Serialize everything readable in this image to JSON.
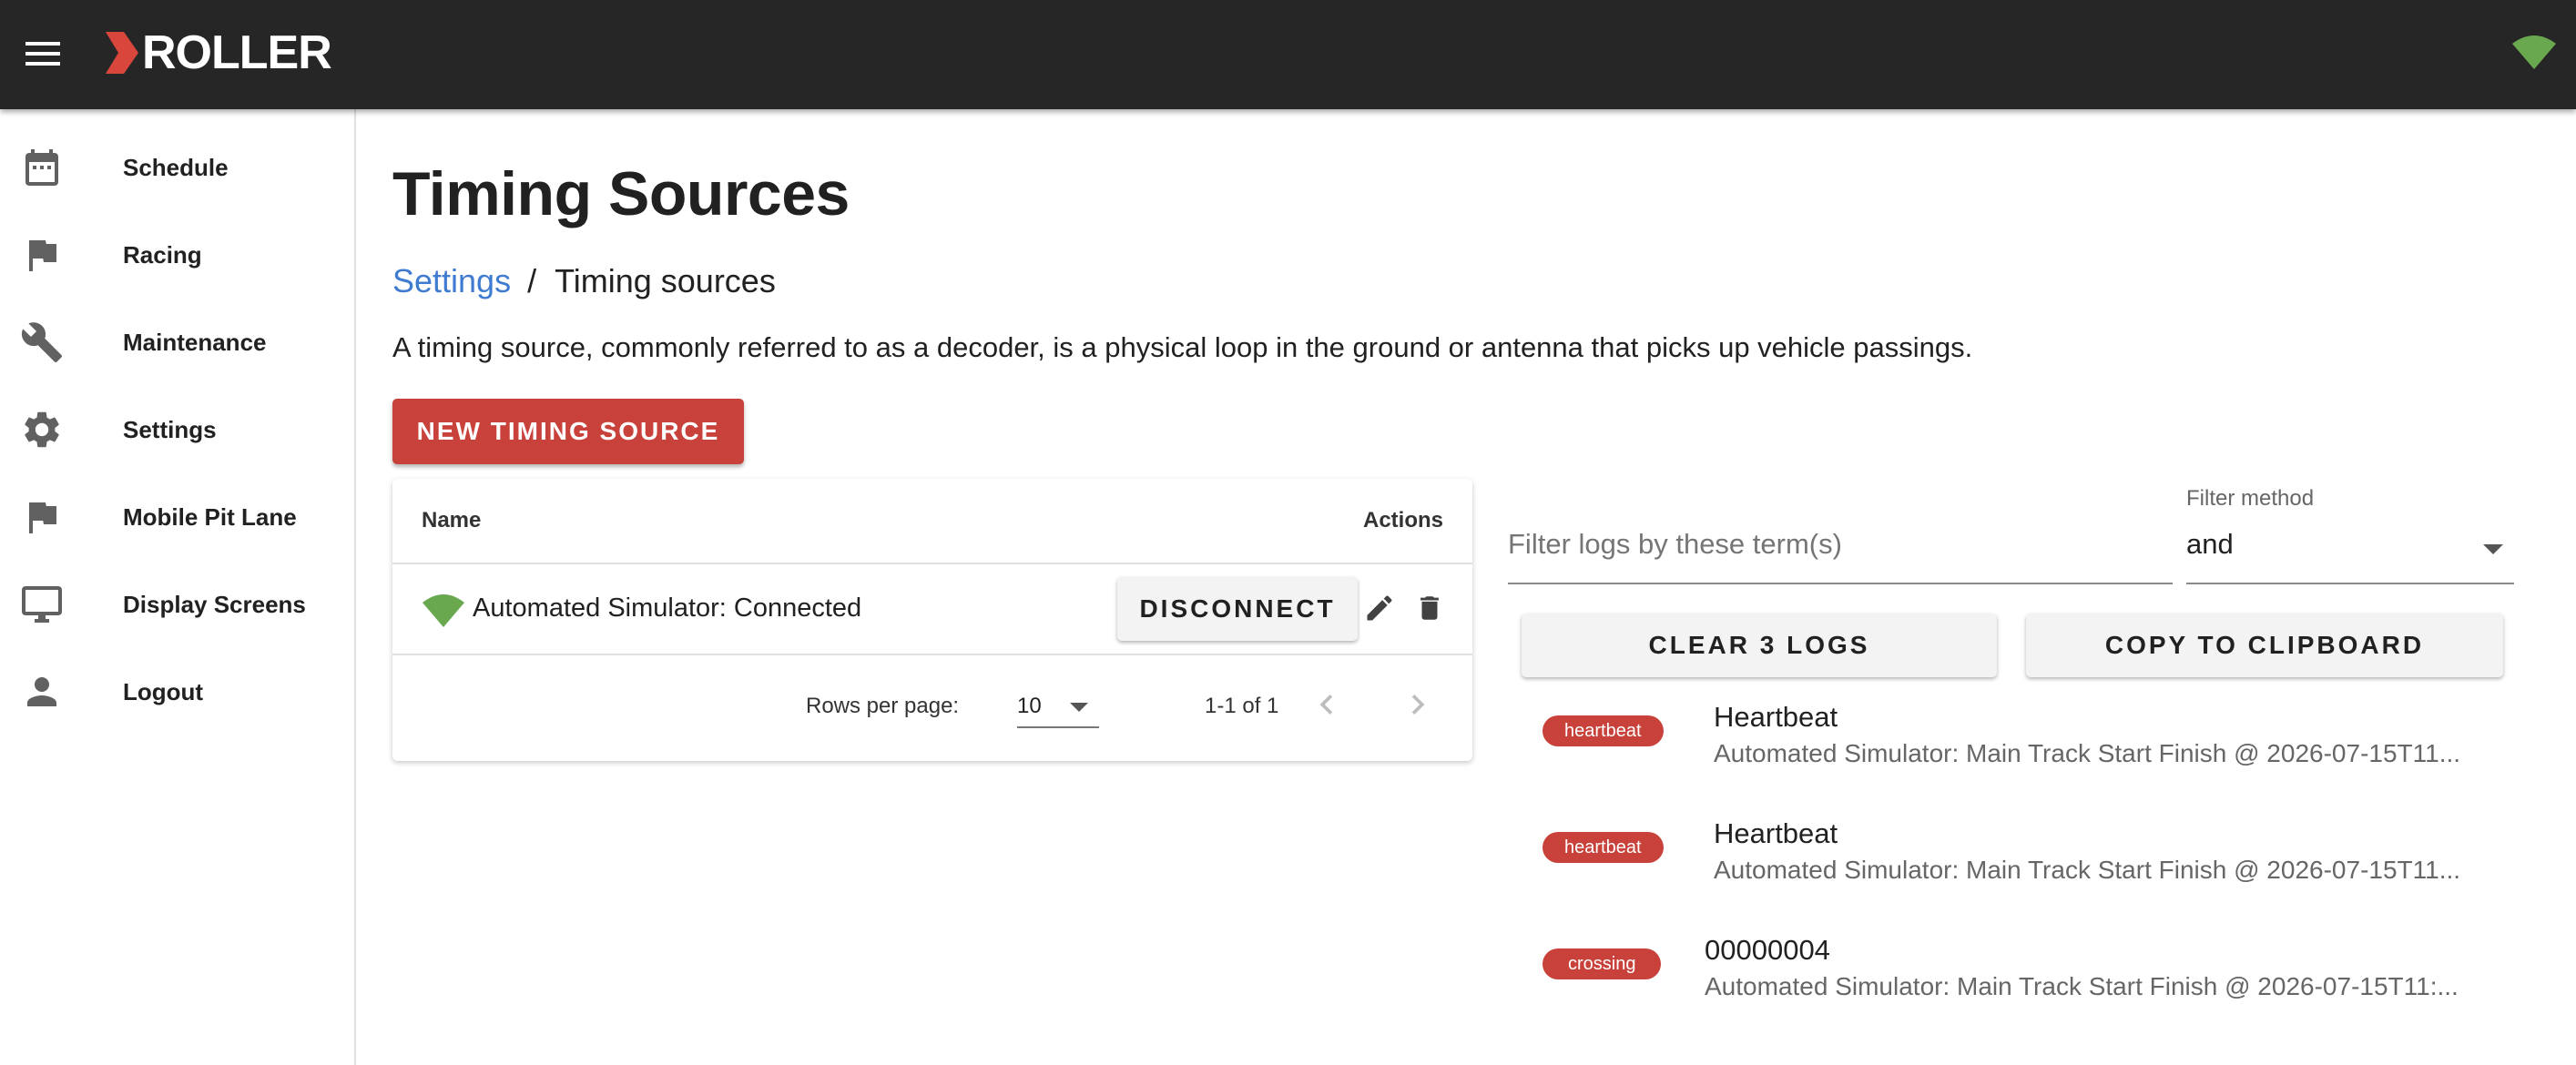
{
  "app": {
    "brand": "ROLLER",
    "accent_color": "#c8413a",
    "connection_color": "#6aa84f"
  },
  "sidebar": {
    "items": [
      {
        "label": "Schedule",
        "icon": "calendar-icon"
      },
      {
        "label": "Racing",
        "icon": "flag-icon"
      },
      {
        "label": "Maintenance",
        "icon": "wrench-icon"
      },
      {
        "label": "Settings",
        "icon": "gear-icon"
      },
      {
        "label": "Mobile Pit Lane",
        "icon": "flag-icon"
      },
      {
        "label": "Display Screens",
        "icon": "monitor-icon"
      },
      {
        "label": "Logout",
        "icon": "person-icon"
      }
    ]
  },
  "page": {
    "title": "Timing Sources",
    "breadcrumb": {
      "parent": "Settings",
      "separator": "/",
      "current": "Timing sources"
    },
    "description": "A timing source, commonly referred to as a decoder, is a physical loop in the ground or antenna that picks up vehicle passings.",
    "new_button": "NEW TIMING SOURCE"
  },
  "table": {
    "columns": {
      "name": "Name",
      "actions": "Actions"
    },
    "rows": [
      {
        "name": "Automated Simulator: Connected",
        "status_icon": "signal-connected-icon",
        "action_label": "DISCONNECT"
      }
    ],
    "pagination": {
      "rows_per_page_label": "Rows per page:",
      "rows_per_page": "10",
      "range": "1-1 of 1"
    }
  },
  "logs": {
    "filter_placeholder": "Filter logs by these term(s)",
    "filter_value": "",
    "filter_method_label": "Filter method",
    "filter_method_value": "and",
    "clear_button": "CLEAR 3 LOGS",
    "copy_button": "COPY TO CLIPBOARD",
    "entries": [
      {
        "tag": "heartbeat",
        "title": "Heartbeat",
        "detail": "Automated Simulator: Main Track Start Finish @ 2026-07-15T11..."
      },
      {
        "tag": "heartbeat",
        "title": "Heartbeat",
        "detail": "Automated Simulator: Main Track Start Finish @ 2026-07-15T11..."
      },
      {
        "tag": "crossing",
        "title": "00000004",
        "detail": "Automated Simulator: Main Track Start Finish @ 2026-07-15T11:..."
      }
    ]
  }
}
